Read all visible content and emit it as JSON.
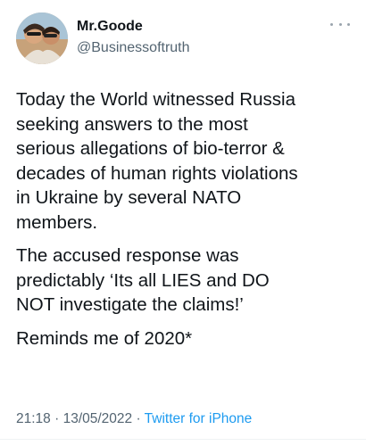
{
  "author": {
    "display_name": "Mr.Goode",
    "handle": "@Businessoftruth"
  },
  "icons": {
    "more": "more-dots-icon"
  },
  "tweet": {
    "paragraphs": [
      "Today the World witnessed Russia\nseeking answers to the most\nserious allegations of bio-terror &\ndecades of human rights violations\nin Ukraine by several NATO\nmembers.",
      "The accused response was\npredictably ‘Its all LIES and DO\nNOT investigate the claims!’",
      "Reminds me of 2020*"
    ]
  },
  "meta": {
    "time": "21:18",
    "date": "13/05/2022",
    "source": "Twitter for iPhone",
    "separator": " · "
  },
  "colors": {
    "text": "#0f1419",
    "secondary": "#536471",
    "link": "#1d9bf0"
  }
}
